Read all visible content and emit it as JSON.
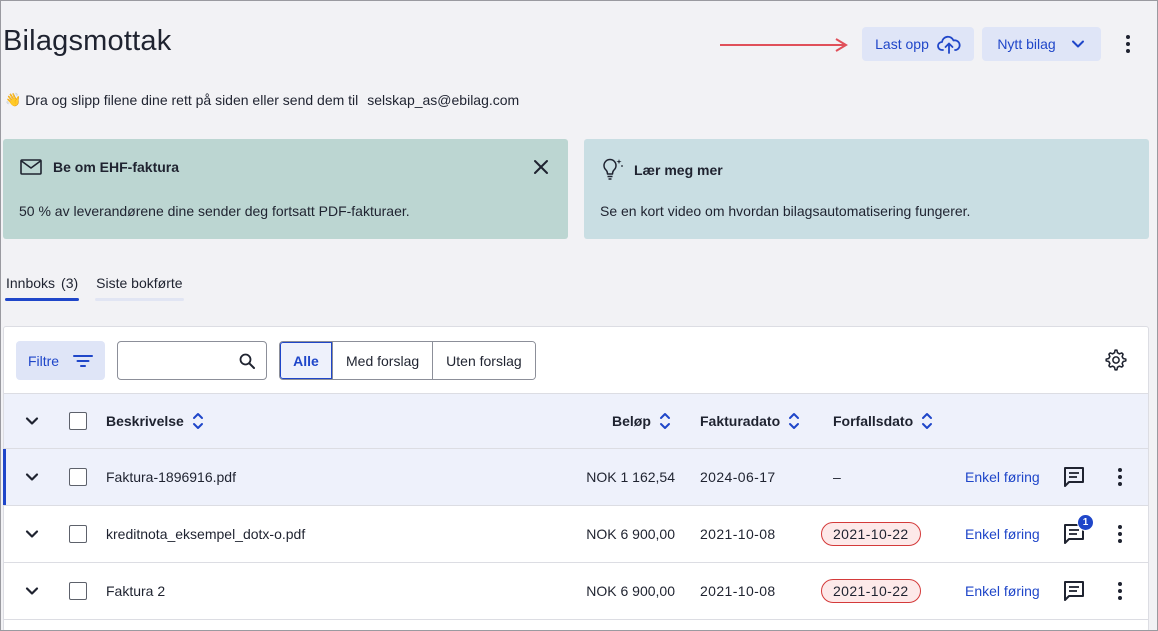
{
  "header": {
    "title": "Bilagsmottak",
    "upload_label": "Last opp",
    "new_label": "Nytt bilag"
  },
  "subtitle": {
    "text": "Dra og slipp filene dine rett på siden eller send dem til",
    "email": "selskap_as@ebilag.com"
  },
  "cards": {
    "ehf": {
      "title": "Be om EHF-faktura",
      "body": "50 % av leverandørene dine sender deg fortsatt PDF-fakturaer."
    },
    "learn": {
      "title": "Lær meg mer",
      "body": "Se en kort video om hvordan bilagsautomatisering fungerer."
    }
  },
  "tabs": {
    "inbox_label": "Innboks",
    "inbox_count": "(3)",
    "posted_label": "Siste bokførte"
  },
  "toolbar": {
    "filter_label": "Filtre",
    "search_value": "",
    "segments": [
      "Alle",
      "Med forslag",
      "Uten forslag"
    ]
  },
  "table": {
    "headers": {
      "description": "Beskrivelse",
      "amount": "Beløp",
      "invoice_date": "Fakturadato",
      "due_date": "Forfallsdato"
    },
    "rows": [
      {
        "description": "Faktura-1896916.pdf",
        "amount": "NOK 1 162,54",
        "invoice_date": "2024-06-17",
        "due_date": "–",
        "due_overdue": false,
        "action": "Enkel føring",
        "comment_badge": ""
      },
      {
        "description": "kreditnota_eksempel_dotx-o.pdf",
        "amount": "NOK 6 900,00",
        "invoice_date": "2021-10-08",
        "due_date": "2021-10-22",
        "due_overdue": true,
        "action": "Enkel føring",
        "comment_badge": "1"
      },
      {
        "description": "Faktura 2",
        "amount": "NOK 6 900,00",
        "invoice_date": "2021-10-08",
        "due_date": "2021-10-22",
        "due_overdue": true,
        "action": "Enkel føring",
        "comment_badge": ""
      }
    ]
  },
  "colors": {
    "accent": "#1f46c9",
    "ehf_card": "#bcd6d2",
    "learn_card": "#c9dee3",
    "overdue_border": "#d43a3a",
    "arrow": "#e0505a"
  }
}
